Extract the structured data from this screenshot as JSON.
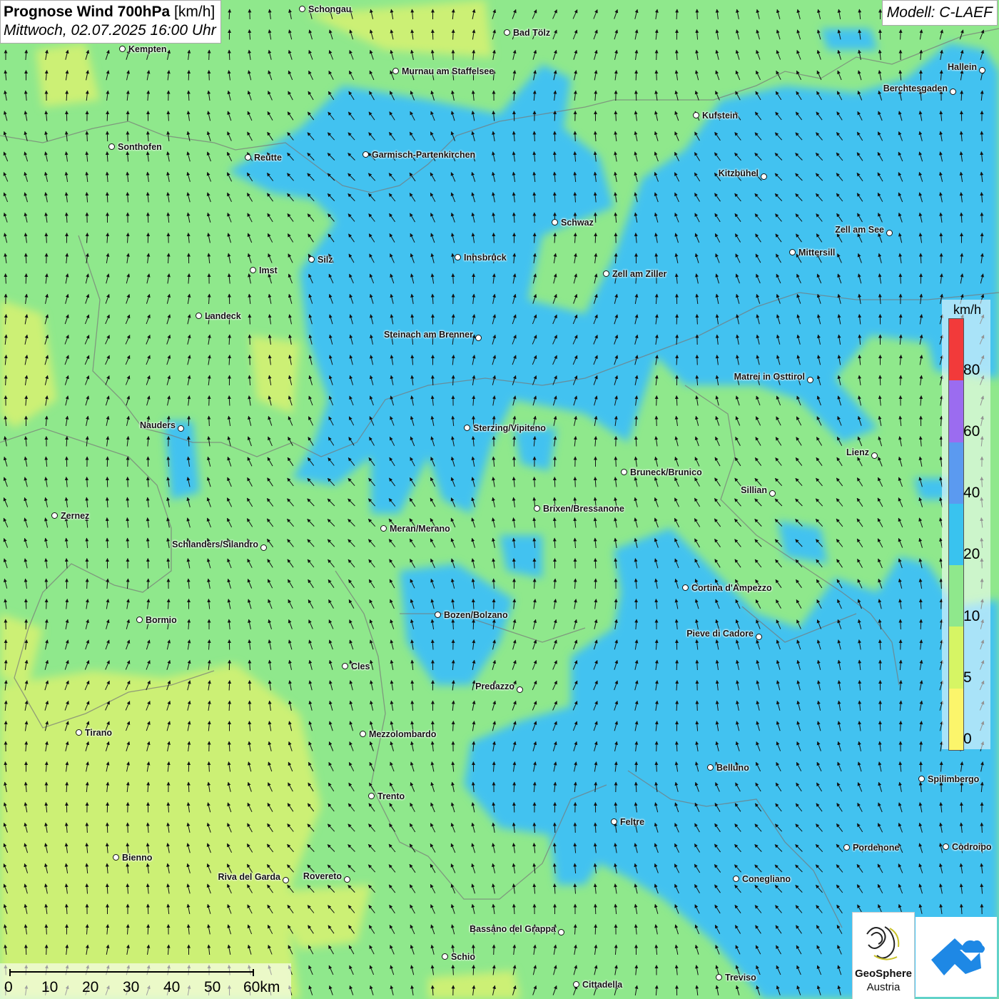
{
  "title": {
    "bold": "Prognose Wind 700hPa",
    "unit": "[km/h]",
    "datetime": "Mittwoch, 02.07.2025 16:00 Uhr"
  },
  "model": "Modell: C-LAEF",
  "legend": {
    "unit": "km/h",
    "labels": [
      "80",
      "60",
      "40",
      "20",
      "10",
      "5",
      "0"
    ],
    "colors": [
      "#f23a3a",
      "#9b6cf0",
      "#5b9af0",
      "#39c3ef",
      "#8fe88c",
      "#d6f564",
      "#fbf56b"
    ]
  },
  "scalebar": {
    "labels": [
      "0",
      "10",
      "20",
      "30",
      "40",
      "50",
      "60km"
    ]
  },
  "logo": {
    "name": "GeoSphere",
    "sub": "Austria"
  },
  "colors": {
    "wind_10_20": "#8fe88c",
    "wind_20_40": "#42c2f0",
    "wind_5_10": "#ccf074",
    "border": "#777777",
    "arrow": "#111111"
  },
  "cities": [
    {
      "name": "Schongau",
      "side": "right"
    },
    {
      "name": "Bad Tölz",
      "side": "right"
    },
    {
      "name": "Kempten",
      "side": "right"
    },
    {
      "name": "Murnau am Staffelsee",
      "side": "right"
    },
    {
      "name": "Hallein",
      "side": "left"
    },
    {
      "name": "Berchtesgaden",
      "side": "left"
    },
    {
      "name": "Kufstein",
      "side": "right"
    },
    {
      "name": "Sonthofen",
      "side": "right"
    },
    {
      "name": "Reutte",
      "side": "right"
    },
    {
      "name": "Garmisch-Partenkirchen",
      "side": "right"
    },
    {
      "name": "Kitzbühel",
      "side": "left"
    },
    {
      "name": "Schwaz",
      "side": "right"
    },
    {
      "name": "Zell am See",
      "side": "left"
    },
    {
      "name": "Mittersill",
      "side": "right"
    },
    {
      "name": "Innsbruck",
      "side": "right"
    },
    {
      "name": "Silz",
      "side": "right"
    },
    {
      "name": "Imst",
      "side": "right"
    },
    {
      "name": "Zell am Ziller",
      "side": "right"
    },
    {
      "name": "Landeck",
      "side": "right"
    },
    {
      "name": "Steinach am Brenner",
      "side": "left"
    },
    {
      "name": "Matrei in Osttirol",
      "side": "left"
    },
    {
      "name": "Nauders",
      "side": "left"
    },
    {
      "name": "Sterzing/Vipiteno",
      "side": "right"
    },
    {
      "name": "Lienz",
      "side": "left"
    },
    {
      "name": "Bruneck/Brunico",
      "side": "right"
    },
    {
      "name": "Sillian",
      "side": "left"
    },
    {
      "name": "Zernez",
      "side": "right"
    },
    {
      "name": "Brixen/Bressanone",
      "side": "right"
    },
    {
      "name": "Meran/Merano",
      "side": "right"
    },
    {
      "name": "Schlanders/Silandro",
      "side": "left"
    },
    {
      "name": "Cortina d'Ampezzo",
      "side": "right"
    },
    {
      "name": "Bozen/Bolzano",
      "side": "right"
    },
    {
      "name": "Bormio",
      "side": "right"
    },
    {
      "name": "Pieve di Cadore",
      "side": "left"
    },
    {
      "name": "Cles",
      "side": "right"
    },
    {
      "name": "Predazzo",
      "side": "left"
    },
    {
      "name": "Tirano",
      "side": "right"
    },
    {
      "name": "Mezzolombardo",
      "side": "right"
    },
    {
      "name": "Belluno",
      "side": "right"
    },
    {
      "name": "Spilimbergo",
      "side": "right"
    },
    {
      "name": "Trento",
      "side": "right"
    },
    {
      "name": "Feltre",
      "side": "right"
    },
    {
      "name": "Pordenone",
      "side": "right"
    },
    {
      "name": "Codroipo",
      "side": "right"
    },
    {
      "name": "Bienno",
      "side": "right"
    },
    {
      "name": "Riva del Garda",
      "side": "left"
    },
    {
      "name": "Rovereto",
      "side": "left"
    },
    {
      "name": "Conegliano",
      "side": "right"
    },
    {
      "name": "Bassano del Grappa",
      "side": "left"
    },
    {
      "name": "Schio",
      "side": "right"
    },
    {
      "name": "Treviso",
      "side": "right"
    },
    {
      "name": "Cittadella",
      "side": "right"
    }
  ]
}
